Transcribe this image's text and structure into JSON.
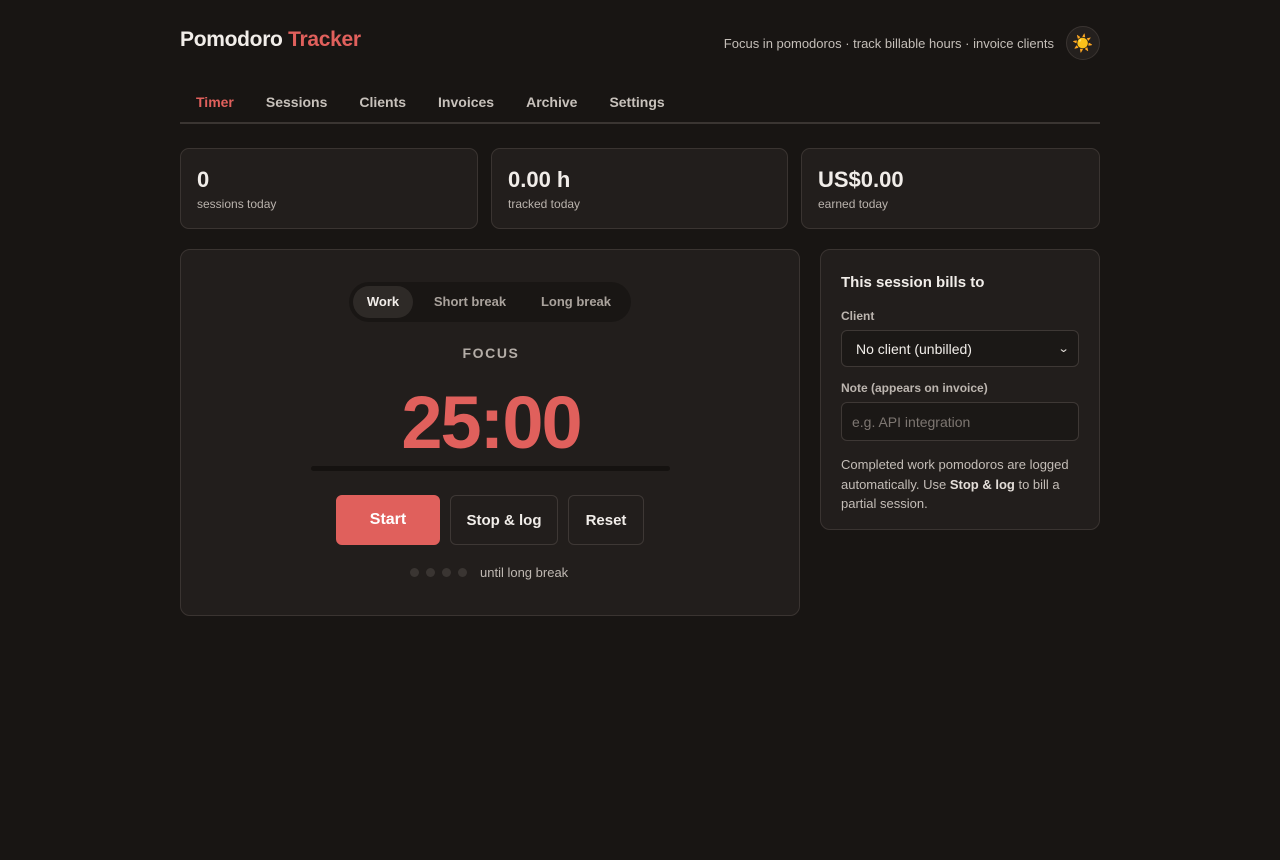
{
  "brand": {
    "name": "Pomodoro",
    "accent": "Tracker"
  },
  "tagline": "Focus in pomodoros · track billable hours · invoice clients",
  "theme_toggle": {
    "icon": "☀️"
  },
  "tabs": [
    {
      "label": "Timer",
      "active": true
    },
    {
      "label": "Sessions",
      "active": false
    },
    {
      "label": "Clients",
      "active": false
    },
    {
      "label": "Invoices",
      "active": false
    },
    {
      "label": "Archive",
      "active": false
    },
    {
      "label": "Settings",
      "active": false
    }
  ],
  "stats": [
    {
      "value": "0",
      "label": "sessions today"
    },
    {
      "value": "0.00 h",
      "label": "tracked today"
    },
    {
      "value": "US$0.00",
      "label": "earned today"
    }
  ],
  "timer": {
    "modes": [
      "Work",
      "Short break",
      "Long break"
    ],
    "selected_mode": "Work",
    "mode_label": "FOCUS",
    "time": "25:00",
    "progress": 0,
    "buttons": {
      "start": "Start",
      "stop": "Stop & log",
      "reset": "Reset"
    },
    "cycle_total": 4,
    "cycle_done": 0,
    "cycle_text": "until long break"
  },
  "billing": {
    "title": "This session bills to",
    "client_label": "Client",
    "client_value": "No client (unbilled)",
    "note_label": "Note (appears on invoice)",
    "note_value": "",
    "note_placeholder": "e.g. API integration",
    "help_prefix": "Completed work pomodoros are logged automatically. Use ",
    "help_bold": "Stop & log",
    "help_suffix": " to bill a partial session."
  },
  "colors": {
    "accent": "#e0605c",
    "background": "#181513",
    "card": "#221e1c"
  }
}
